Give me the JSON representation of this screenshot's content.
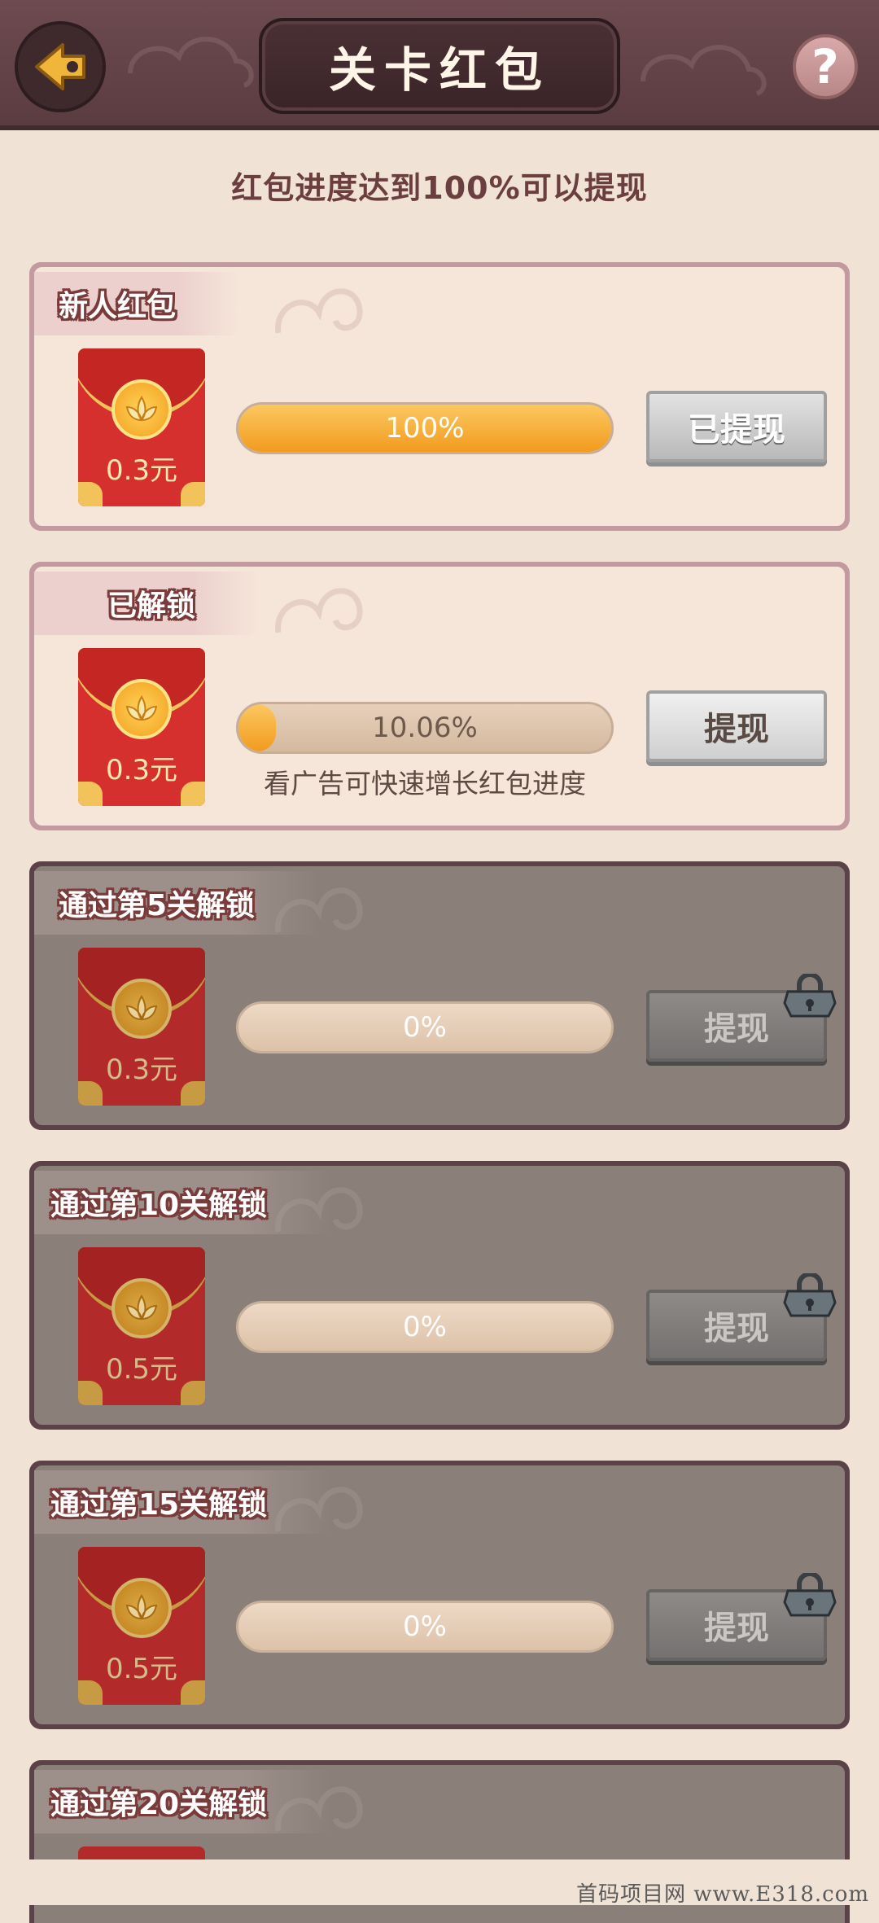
{
  "header": {
    "title": "关卡红包",
    "back_icon": "back-arrow-icon",
    "help_label": "?"
  },
  "subtitle": "红包进度达到100%可以提现",
  "cards": [
    {
      "tab": "新人红包",
      "amount": "0.3元",
      "progress": 100,
      "progress_label": "100%",
      "button": "已提现",
      "locked": false,
      "hint": ""
    },
    {
      "tab": "已解锁",
      "amount": "0.3元",
      "progress": 10.06,
      "progress_label": "10.06%",
      "button": "提现",
      "locked": false,
      "hint": "看广告可快速增长红包进度"
    },
    {
      "tab": "通过第5关解锁",
      "amount": "0.3元",
      "progress": 0,
      "progress_label": "0%",
      "button": "提现",
      "locked": true,
      "hint": ""
    },
    {
      "tab": "通过第10关解锁",
      "amount": "0.5元",
      "progress": 0,
      "progress_label": "0%",
      "button": "提现",
      "locked": true,
      "hint": ""
    },
    {
      "tab": "通过第15关解锁",
      "amount": "0.5元",
      "progress": 0,
      "progress_label": "0%",
      "button": "提现",
      "locked": true,
      "hint": ""
    },
    {
      "tab": "通过第20关解锁",
      "amount": "",
      "progress": 0,
      "progress_label": "",
      "button": "",
      "locked": true,
      "hint": ""
    }
  ],
  "watermark": "首码项目网 www.E318.com",
  "colors": {
    "header": "#5b3c41",
    "background": "#f1e2d6",
    "progress_fill": "#f29b1e",
    "envelope": "#d6302e"
  }
}
